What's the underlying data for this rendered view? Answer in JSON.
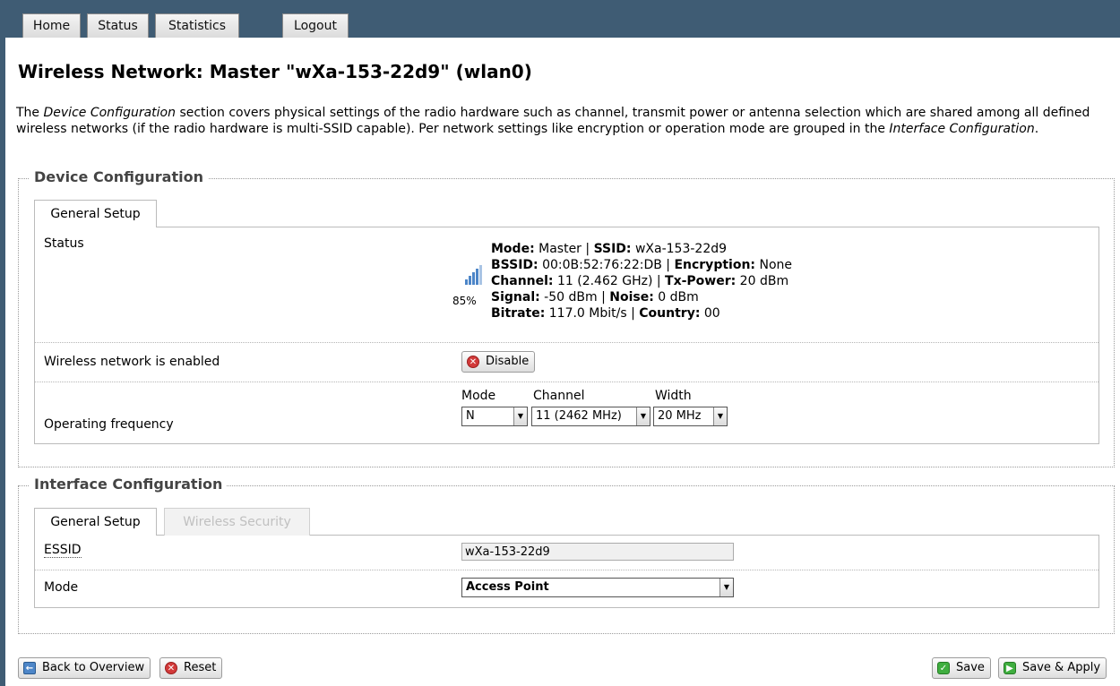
{
  "nav": {
    "tabs": [
      {
        "label": "Home"
      },
      {
        "label": "Status"
      },
      {
        "label": "Statistics"
      },
      {
        "label": "Logout"
      }
    ]
  },
  "page": {
    "title": "Wireless Network: Master \"wXa-153-22d9\" (wlan0)",
    "intro_1": "The ",
    "intro_em1": "Device Configuration",
    "intro_2": " section covers physical settings of the radio hardware such as channel, transmit power or antenna selection which are shared among all defined wireless networks (if the radio hardware is multi-SSID capable). Per network settings like encryption or operation mode are grouped in the ",
    "intro_em2": "Interface Configuration",
    "intro_3": "."
  },
  "device_config": {
    "legend": "Device Configuration",
    "tab": "General Setup",
    "status": {
      "label": "Status",
      "signal_percent": "85%",
      "signal_level": 0.85,
      "mode_key": "Mode:",
      "mode_val": " Master | ",
      "ssid_key": "SSID:",
      "ssid_val": " wXa-153-22d9",
      "bssid_key": "BSSID:",
      "bssid_val": " 00:0B:52:76:22:DB | ",
      "enc_key": "Encryption:",
      "enc_val": " None",
      "channel_key": "Channel:",
      "channel_val": " 11 (2.462 GHz) | ",
      "txp_key": "Tx-Power:",
      "txp_val": " 20 dBm",
      "signal_key": "Signal:",
      "signal_val": " -50 dBm | ",
      "noise_key": "Noise:",
      "noise_val": " 0 dBm",
      "bitrate_key": "Bitrate:",
      "bitrate_val": " 117.0 Mbit/s | ",
      "country_key": "Country:",
      "country_val": " 00"
    },
    "enabled": {
      "label": "Wireless network is enabled",
      "button": "Disable"
    },
    "frequency": {
      "label": "Operating frequency",
      "mode_label": "Mode",
      "mode_value": "N",
      "channel_label": "Channel",
      "channel_value": "11 (2462 MHz)",
      "width_label": "Width",
      "width_value": "20 MHz"
    }
  },
  "interface_config": {
    "legend": "Interface Configuration",
    "tabs": [
      {
        "label": "General Setup"
      },
      {
        "label": "Wireless Security"
      }
    ],
    "essid_label": "ESSID",
    "essid_value": "wXa-153-22d9",
    "mode_label": "Mode",
    "mode_value": "Access Point"
  },
  "footer": {
    "back": "Back to Overview",
    "reset": "Reset",
    "save": "Save",
    "save_apply": "Save & Apply"
  },
  "colors": {
    "topbar": "#3f5c74",
    "signal_bars": "#4d86c8"
  }
}
